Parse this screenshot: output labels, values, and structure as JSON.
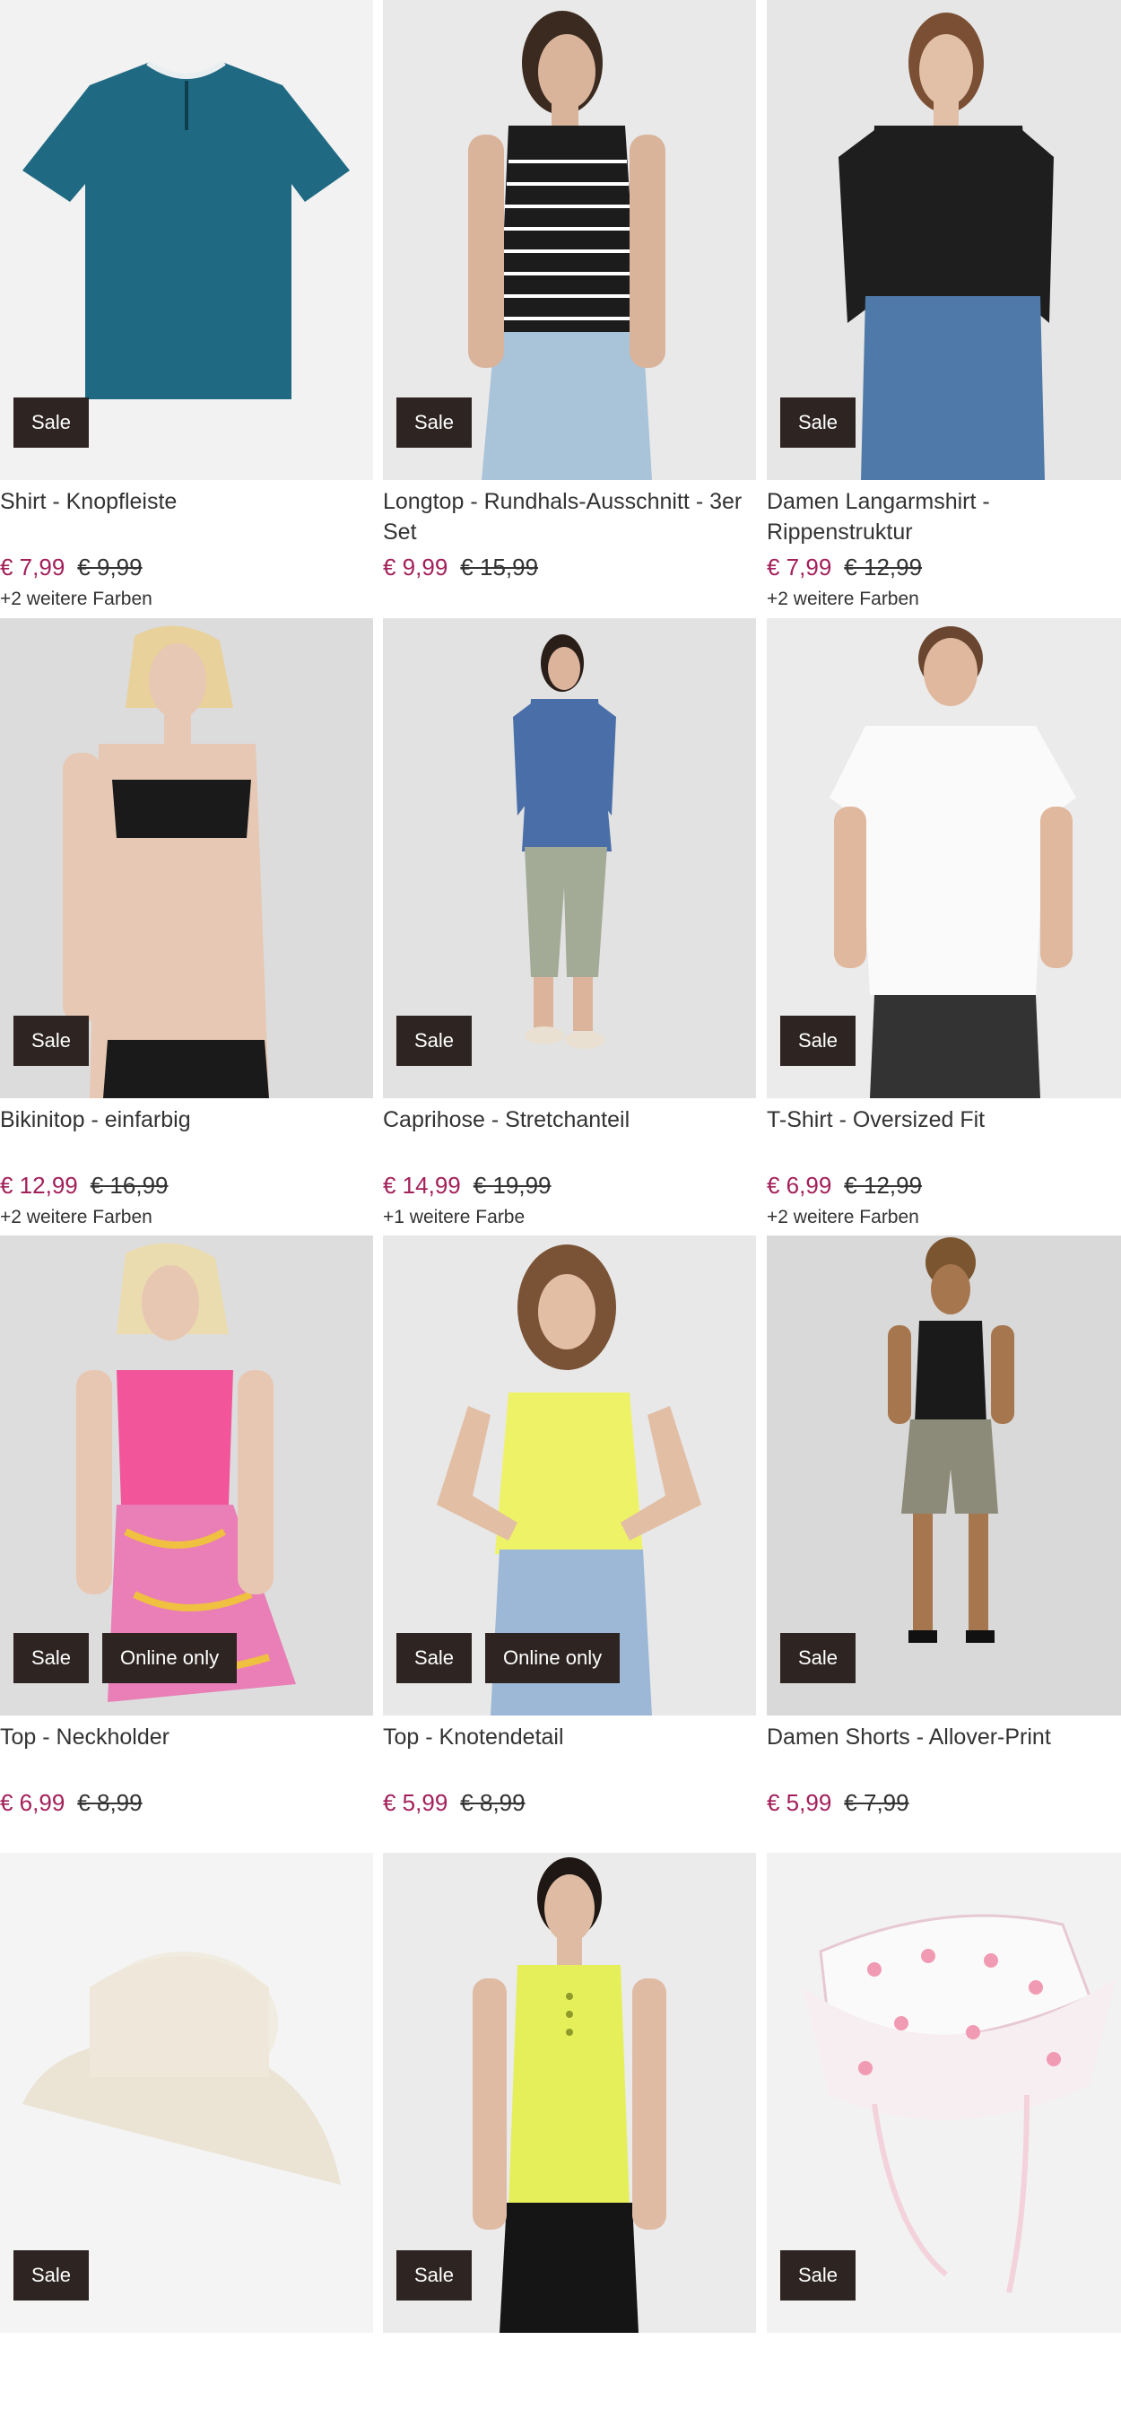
{
  "products": [
    {
      "title": "Shirt - Knopfleiste",
      "price": "€ 7,99",
      "old_price": "€ 9,99",
      "badges": [
        "Sale"
      ],
      "colors_note": "+2 weitere Farben",
      "image": "teal-tshirt"
    },
    {
      "title": "Longtop - Rundhals-Ausschnitt - 3er Set",
      "price": "€ 9,99",
      "old_price": "€ 15,99",
      "badges": [
        "Sale"
      ],
      "colors_note": "",
      "image": "striped-tank-model"
    },
    {
      "title": "Damen Langarmshirt - Rippenstruktur",
      "price": "€ 7,99",
      "old_price": "€ 12,99",
      "badges": [
        "Sale"
      ],
      "colors_note": "+2 weitere Farben",
      "image": "black-longsleeve-model"
    },
    {
      "title": "Bikinitop - einfarbig",
      "price": "€ 12,99",
      "old_price": "€ 16,99",
      "badges": [
        "Sale"
      ],
      "colors_note": "+2 weitere Farben",
      "image": "black-bikini-model"
    },
    {
      "title": "Caprihose - Stretchanteil",
      "price": "€ 14,99",
      "old_price": "€ 19,99",
      "badges": [
        "Sale"
      ],
      "colors_note": "+1 weitere Farbe",
      "image": "caprihose-model"
    },
    {
      "title": "T-Shirt - Oversized Fit",
      "price": "€ 6,99",
      "old_price": "€ 12,99",
      "badges": [
        "Sale"
      ],
      "colors_note": "+2 weitere Farben",
      "image": "white-tshirt-model"
    },
    {
      "title": "Top - Neckholder",
      "price": "€ 6,99",
      "old_price": "€ 8,99",
      "badges": [
        "Sale",
        "Online only"
      ],
      "colors_note": "",
      "image": "pink-neckholder-model"
    },
    {
      "title": "Top - Knotendetail",
      "price": "€ 5,99",
      "old_price": "€ 8,99",
      "badges": [
        "Sale",
        "Online only"
      ],
      "colors_note": "",
      "image": "yellow-knot-top-model"
    },
    {
      "title": "Damen Shorts - Allover-Print",
      "price": "€ 5,99",
      "old_price": "€ 7,99",
      "badges": [
        "Sale"
      ],
      "colors_note": "",
      "image": "printed-shorts-model"
    },
    {
      "title": "",
      "price": "",
      "old_price": "",
      "badges": [
        "Sale"
      ],
      "colors_note": "",
      "image": "cream-bucket-hat"
    },
    {
      "title": "",
      "price": "",
      "old_price": "",
      "badges": [
        "Sale"
      ],
      "colors_note": "",
      "image": "lime-tank-model"
    },
    {
      "title": "",
      "price": "",
      "old_price": "",
      "badges": [
        "Sale"
      ],
      "colors_note": "",
      "image": "flamingo-sun-hat"
    }
  ],
  "colors": {
    "sale_price": "#a3205a",
    "badge_bg": "#2e2523",
    "badge_text": "#ffffff"
  }
}
